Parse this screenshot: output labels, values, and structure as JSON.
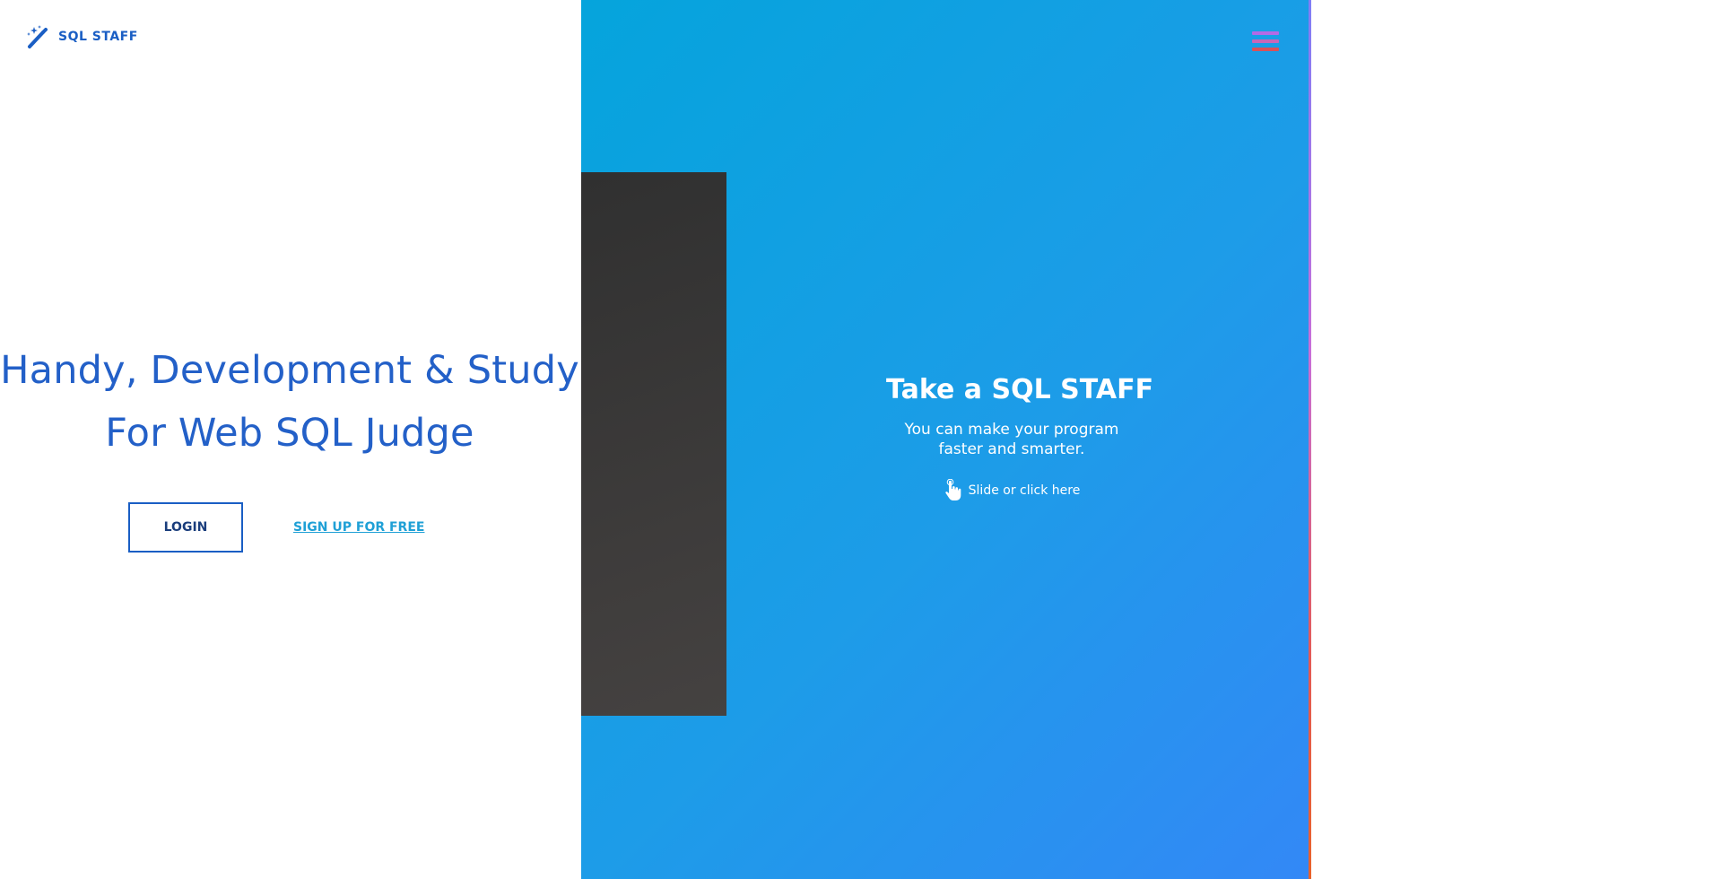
{
  "brand": {
    "name": "SQL STAFF",
    "icon": "magic-wand-icon",
    "color": "#1a5ec4"
  },
  "hero": {
    "line1": "Handy, Development & Study",
    "line2": "For Web SQL Judge",
    "color": "#2360c8"
  },
  "actions": {
    "login_label": "LOGIN",
    "signup_label": "SIGN UP FOR FREE"
  },
  "menu": {
    "icon": "hamburger-menu-icon"
  },
  "promo": {
    "title": "Take a SQL STAFF",
    "subtitle_line1": "You can make your program",
    "subtitle_line2": "faster and smarter.",
    "cta_label": "Slide or click here",
    "cta_icon": "hand-pointer-icon"
  },
  "colors": {
    "panel_gradient_start": "#05a4dc",
    "panel_gradient_end": "#3388f6",
    "dark_card": "#353434",
    "edge_strip_top": "#7f7ef6",
    "edge_strip_bottom": "#e9622a"
  }
}
